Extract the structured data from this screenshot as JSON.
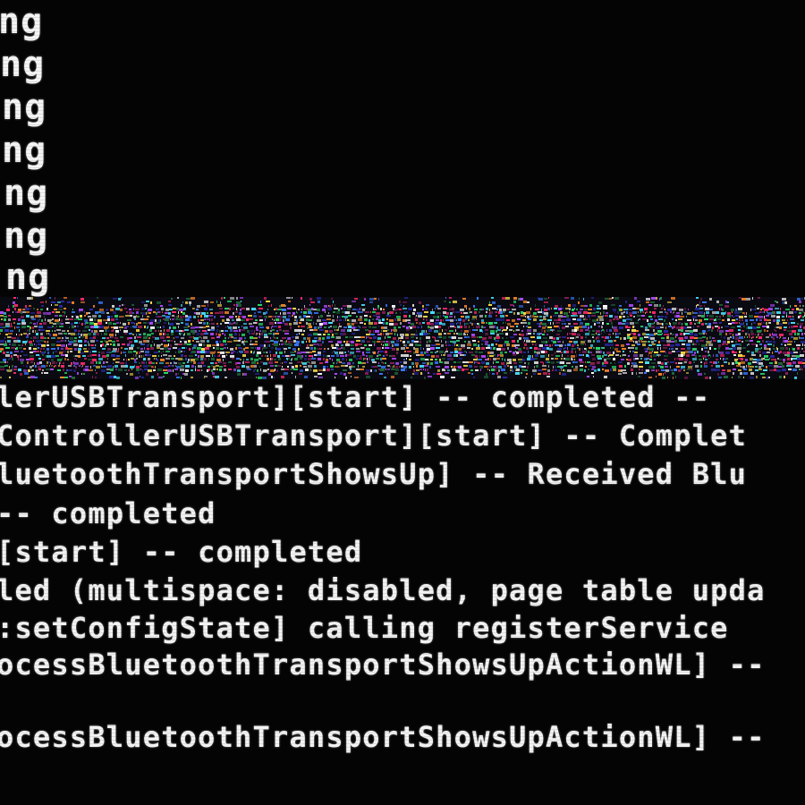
{
  "upper_lines": [
    "ng",
    "ng",
    "ng",
    "ng",
    "ng",
    "ng",
    "ng"
  ],
  "log_lines": [
    "lerUSBTransport][start] -- completed -- ",
    "ControllerUSBTransport][start] -- Complet",
    "luetoothTransportShowsUp] -- Received Blu",
    "-- completed",
    "[start] -- completed",
    "led (multispace: disabled, page table upda",
    ":setConfigState] calling registerService",
    "ocessBluetoothTransportShowsUpActionWL] --",
    "",
    "ocessBluetoothTransportShowsUpActionWL] --"
  ],
  "colors": {
    "background": "#040404",
    "text": "#f2f2f2"
  }
}
